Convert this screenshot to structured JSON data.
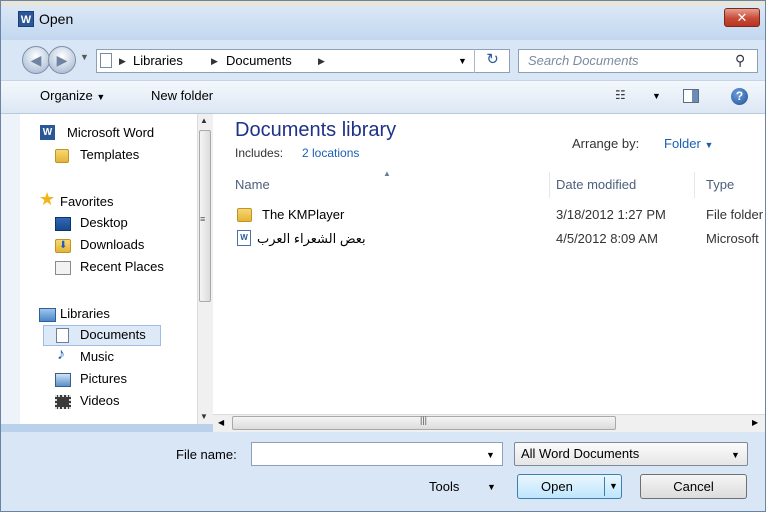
{
  "window": {
    "title": "Open",
    "app_icon_letter": "W",
    "close_glyph": "✕"
  },
  "address": {
    "crumbs": [
      "Libraries",
      "Documents"
    ],
    "search_placeholder": "Search Documents"
  },
  "toolbar": {
    "organize": "Organize",
    "new_folder": "New folder",
    "help": "?"
  },
  "nav": {
    "microsoft_word": "Microsoft Word",
    "templates": "Templates",
    "favorites": "Favorites",
    "desktop": "Desktop",
    "downloads": "Downloads",
    "recent_places": "Recent Places",
    "libraries": "Libraries",
    "documents": "Documents",
    "music": "Music",
    "pictures": "Pictures",
    "videos": "Videos"
  },
  "library": {
    "title": "Documents library",
    "includes_label": "Includes:",
    "includes_link": "2 locations",
    "arrange_label": "Arrange by:",
    "arrange_value": "Folder"
  },
  "columns": {
    "name": "Name",
    "date": "Date modified",
    "type": "Type"
  },
  "files": [
    {
      "name": "The KMPlayer",
      "date": "3/18/2012 1:27 PM",
      "type": "File folder",
      "icon": "folder-icon"
    },
    {
      "name": "بعض الشعراء العرب",
      "date": "4/5/2012 8:09 AM",
      "type": "Microsoft",
      "icon": "word-doc-icon"
    }
  ],
  "bottom": {
    "file_name_label": "File name:",
    "file_name_value": "",
    "file_type": "All Word Documents",
    "tools": "Tools",
    "open": "Open",
    "cancel": "Cancel"
  },
  "colors": {
    "link": "#1a5fb4",
    "library_title": "#1e3287",
    "close_red": "#c74a37"
  }
}
